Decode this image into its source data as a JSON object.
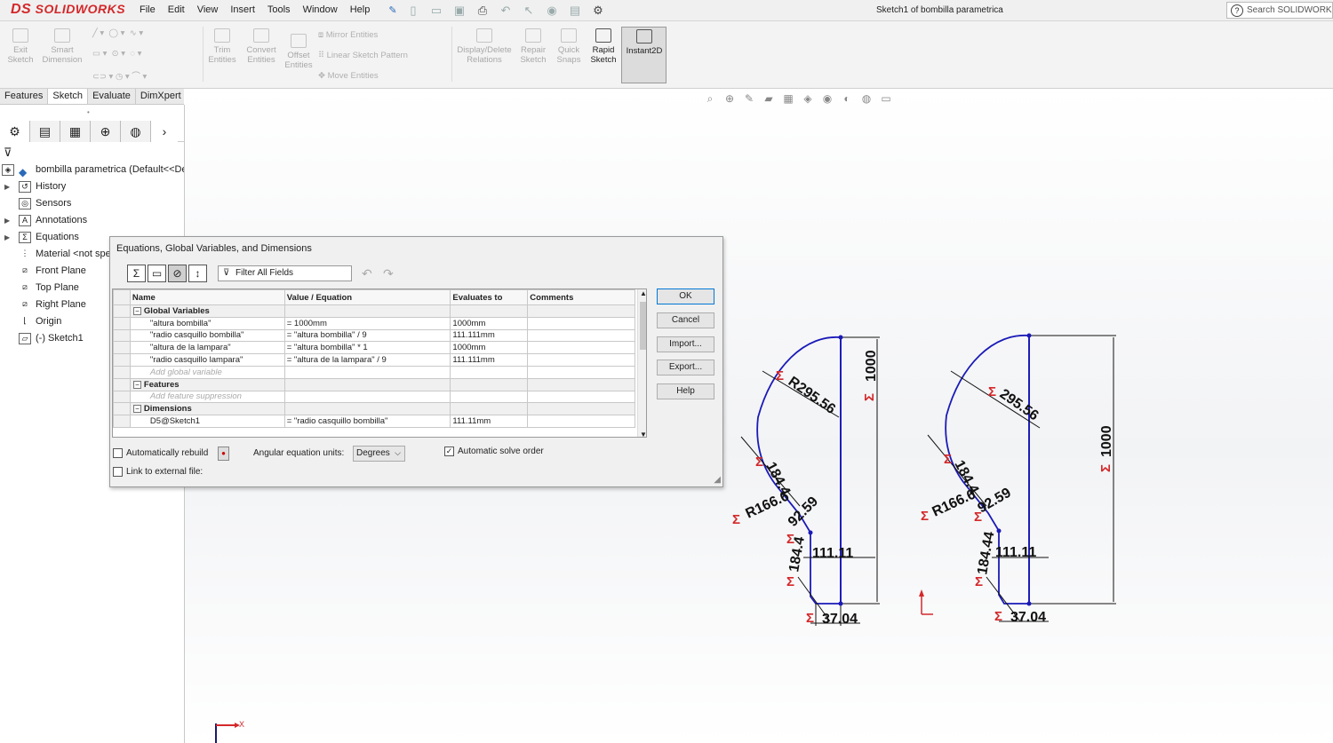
{
  "app": {
    "brand_prefix": "DS",
    "brand": "SOLIDWORKS"
  },
  "menu": [
    "File",
    "Edit",
    "View",
    "Insert",
    "Tools",
    "Window",
    "Help"
  ],
  "doc_title": "Sketch1 of bombilla parametrica",
  "search_placeholder": "Search SOLIDWORKS",
  "ribbon": {
    "exit_sketch": [
      "Exit",
      "Sketch"
    ],
    "smart_dimension": [
      "Smart",
      "Dimension"
    ],
    "trim_entities": [
      "Trim",
      "Entities"
    ],
    "convert_entities": [
      "Convert",
      "Entities"
    ],
    "offset_entities": [
      "Offset",
      "Entities"
    ],
    "mirror_entities": "Mirror Entities",
    "linear_sketch_pattern": "Linear Sketch Pattern",
    "move_entities": "Move Entities",
    "display_delete_relations": [
      "Display/Delete",
      "Relations"
    ],
    "repair_sketch": [
      "Repair",
      "Sketch"
    ],
    "quick_snaps": [
      "Quick",
      "Snaps"
    ],
    "rapid_sketch": [
      "Rapid",
      "Sketch"
    ],
    "instant2d": "Instant2D"
  },
  "tabs": [
    "Features",
    "Sketch",
    "Evaluate",
    "DimXpert"
  ],
  "tree": {
    "root": "bombilla parametrica  (Default<<De",
    "items": [
      "History",
      "Sensors",
      "Annotations",
      "Equations",
      "Material <not spe",
      "Front Plane",
      "Top Plane",
      "Right Plane",
      "Origin",
      "(-) Sketch1"
    ]
  },
  "dialog": {
    "title": "Equations, Global Variables, and Dimensions",
    "filter_placeholder": "Filter All Fields",
    "columns": [
      "Name",
      "Value / Equation",
      "Evaluates to",
      "Comments"
    ],
    "sections": {
      "global": "Global Variables",
      "features": "Features",
      "dimensions": "Dimensions"
    },
    "global_rows": [
      {
        "name": "\"altura bombilla\"",
        "value": "= 1000mm",
        "eval": "1000mm"
      },
      {
        "name": "\"radio casquillo bombilla\"",
        "value": "= \"altura bombilla\" / 9",
        "eval": "111.111mm"
      },
      {
        "name": "\"altura de la lampara\"",
        "value": "= \"altura bombilla\" * 1",
        "eval": "1000mm"
      },
      {
        "name": "\"radio casquillo lampara\"",
        "value": "= \"altura de la lampara\" / 9",
        "eval": "111.111mm"
      }
    ],
    "add_global": "Add global variable",
    "add_feature": "Add feature suppression",
    "dim_rows": [
      {
        "name": "D5@Sketch1",
        "value": "= \"radio casquillo bombilla\"",
        "eval": "111.11mm"
      }
    ],
    "buttons": {
      "ok": "OK",
      "cancel": "Cancel",
      "import": "Import...",
      "export": "Export...",
      "help": "Help"
    },
    "auto_rebuild": "Automatically rebuild",
    "angular_units_label": "Angular equation units:",
    "angular_units_value": "Degrees",
    "auto_solve": "Automatic solve order",
    "link_external": "Link to external file:"
  },
  "sketch_dims": {
    "left": {
      "r_big": "R295.56",
      "height": "1000",
      "r_small": "R166.6",
      "len_a": "184.4",
      "len_b": "92.59",
      "len_c": "184.4",
      "radius": "111.11",
      "bottom": "37.04"
    },
    "right": {
      "r_big": "295.56",
      "height": "1000",
      "r_small": "R166.6",
      "len_a": "184.4",
      "len_b": "92.59",
      "len_c": "184.44",
      "radius": "111.11",
      "bottom": "37.04"
    }
  },
  "axis_label": "X",
  "colors": {
    "brand": "#d4282a",
    "sketch_line": "#1a1ab8",
    "dim_line": "#111111"
  }
}
